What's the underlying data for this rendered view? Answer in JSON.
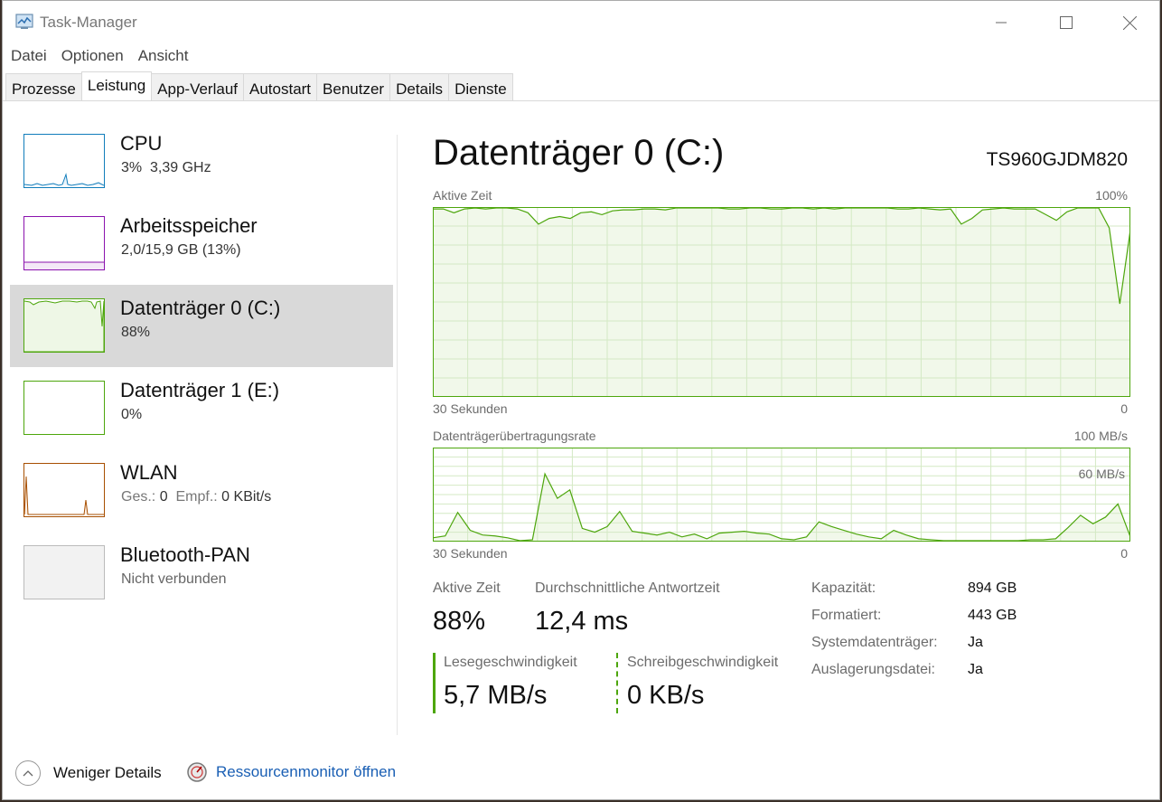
{
  "window": {
    "title": "Task-Manager"
  },
  "menu": [
    "Datei",
    "Optionen",
    "Ansicht"
  ],
  "tabs": [
    "Prozesse",
    "Leistung",
    "App-Verlauf",
    "Autostart",
    "Benutzer",
    "Details",
    "Dienste"
  ],
  "active_tab": "Leistung",
  "sidebar": {
    "items": [
      {
        "name": "CPU",
        "sub": "3%  3,39 GHz",
        "color": "#117dbb"
      },
      {
        "name": "Arbeitsspeicher",
        "sub": "2,0/15,9 GB (13%)",
        "color": "#8b12ae"
      },
      {
        "name": "Datenträger 0 (C:)",
        "sub": "88%",
        "color": "#4da60c"
      },
      {
        "name": "Datenträger 1 (E:)",
        "sub": "0%",
        "color": "#4da60c"
      },
      {
        "name": "WLAN",
        "sub_parts": [
          "Ges.:",
          "0",
          "Empf.:",
          "0 KBit/s"
        ],
        "color": "#a74f01"
      },
      {
        "name": "Bluetooth-PAN",
        "sub": "Nicht verbunden",
        "color": "#aaaaaa"
      }
    ]
  },
  "main": {
    "title": "Datenträger 0 (C:)",
    "model": "TS960GJDM820",
    "graph1": {
      "label": "Aktive Zeit",
      "max_label": "100%",
      "time_label": "30 Sekunden",
      "min_label": "0",
      "values": [
        99,
        99,
        97,
        99,
        99.5,
        99,
        99.5,
        99.5,
        99,
        97,
        91,
        94,
        95,
        94,
        97,
        97.5,
        96,
        98,
        98.5,
        98.5,
        99,
        99,
        98.5,
        99.5,
        99.5,
        99.5,
        99.5,
        99.5,
        99,
        99,
        99.5,
        99.5,
        99,
        99,
        99.5,
        99.5,
        99,
        99.5,
        99,
        99.5,
        99.5,
        99.5,
        99.5,
        99.5,
        99,
        99,
        99.5,
        99,
        98.5,
        99,
        91,
        94,
        98.5,
        99,
        99.5,
        99,
        99,
        99,
        96,
        93,
        97.5,
        99.5,
        99.5,
        99.5,
        89,
        49,
        88
      ]
    },
    "graph2": {
      "label": "Datenträgerübertragungsrate",
      "max_label": "100 MB/s",
      "mid_label": "60 MB/s",
      "time_label": "30 Sekunden",
      "min_label": "0",
      "values": [
        4,
        6,
        31,
        12,
        7,
        6,
        4,
        1,
        2,
        72,
        46,
        55,
        14,
        10,
        16,
        32,
        11,
        9,
        7,
        10,
        5,
        8,
        3,
        9,
        10,
        11,
        9,
        8,
        3,
        2,
        5,
        21,
        16,
        12,
        8,
        5,
        3,
        12,
        7,
        3,
        2,
        1,
        1,
        1,
        1,
        1,
        1,
        1,
        2,
        2,
        3,
        15,
        28,
        19,
        26,
        40,
        5
      ]
    }
  },
  "stats": {
    "active_time_label": "Aktive Zeit",
    "active_time_value": "88%",
    "resp_label": "Durchschnittliche Antwortzeit",
    "resp_value": "12,4 ms",
    "read_label": "Lesegeschwindigkeit",
    "read_value": "5,7 MB/s",
    "write_label": "Schreibgeschwindigkeit",
    "write_value": "0 KB/s"
  },
  "props": [
    {
      "label": "Kapazität:",
      "value": "894 GB"
    },
    {
      "label": "Formatiert:",
      "value": "443 GB"
    },
    {
      "label": "Systemdatenträger:",
      "value": "Ja"
    },
    {
      "label": "Auslagerungsdatei:",
      "value": "Ja"
    }
  ],
  "footer": {
    "less_details": "Weniger Details",
    "resource_monitor": "Ressourcenmonitor öffnen"
  },
  "colors": {
    "disk_green": "#4da60c",
    "disk_fill": "#eef7e6",
    "grid": "#d4e9c4"
  }
}
